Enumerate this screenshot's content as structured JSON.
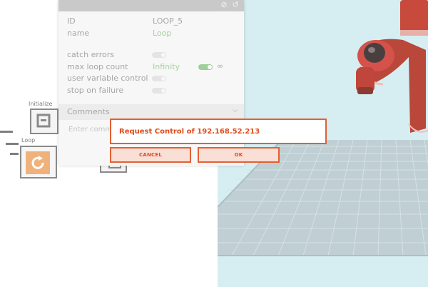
{
  "canvas": {
    "nodes": [
      {
        "label": "Initialize",
        "kind": "initialize-node"
      },
      {
        "label": "Loop",
        "kind": "loop-node"
      }
    ]
  },
  "inspector": {
    "fields": {
      "id_label": "ID",
      "id_value": "LOOP_5",
      "name_label": "name",
      "name_value": "Loop",
      "catch_errors_label": "catch errors",
      "max_loop_count_label": "max loop count",
      "max_loop_count_value": "Infinity",
      "infinity_symbol": "∞",
      "user_variable_control_label": "user variable control",
      "stop_on_failure_label": "stop on failure"
    },
    "toggles": {
      "catch_errors": false,
      "max_loop_infinite": true,
      "user_variable_control": false,
      "stop_on_failure": false
    },
    "comments": {
      "header": "Comments",
      "placeholder": "Enter comm"
    },
    "colors": {
      "green": "#9fcf9a"
    }
  },
  "dialog": {
    "title": "Request Control of 192.168.52.213",
    "cancel_label": "CANCEL",
    "ok_label": "OK",
    "accent": "#e26033"
  }
}
